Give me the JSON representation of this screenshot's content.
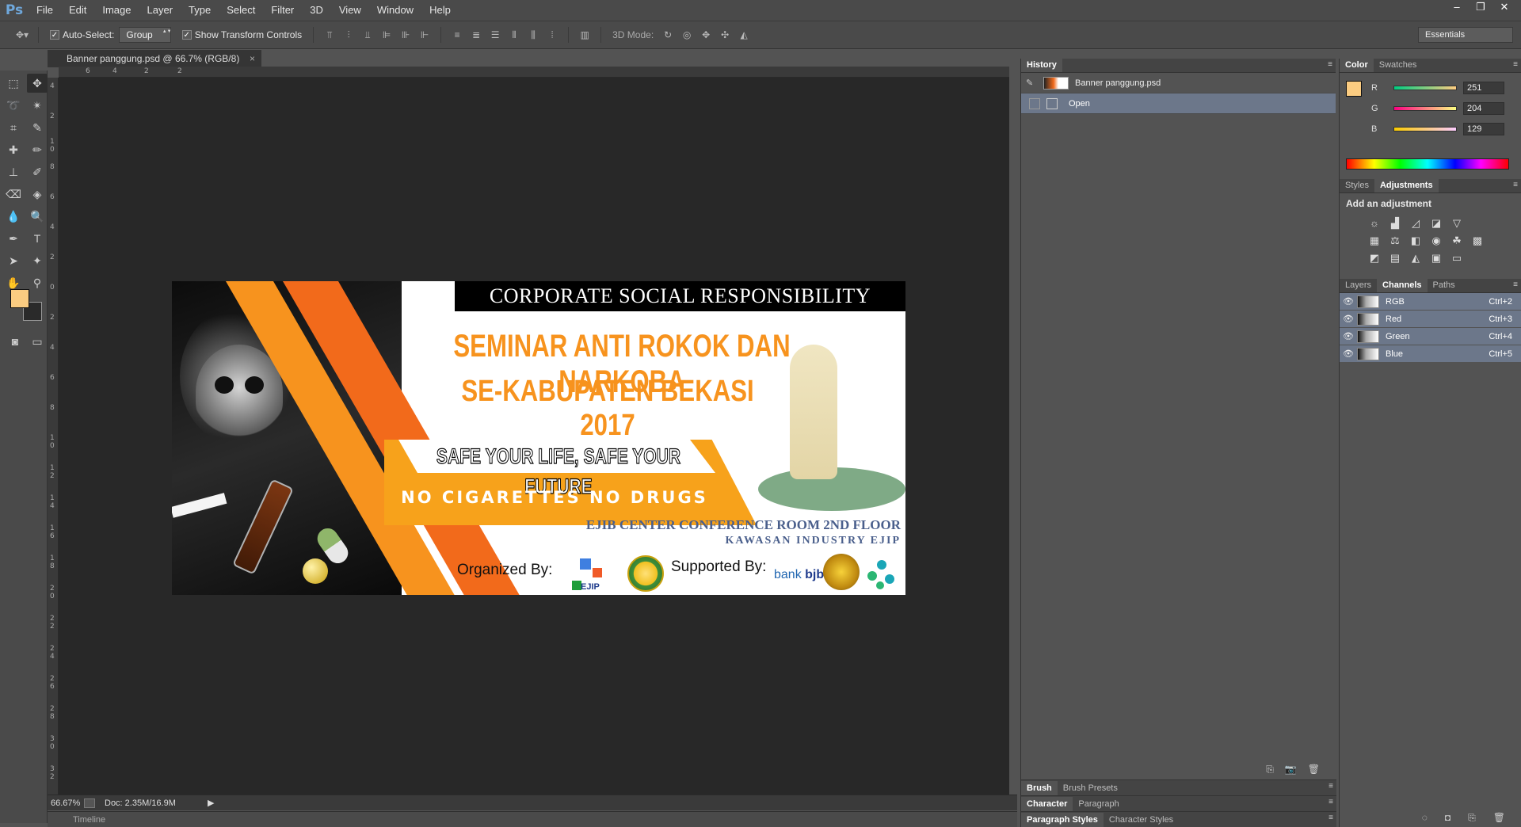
{
  "app": {
    "logo": "Ps",
    "menu": [
      "File",
      "Edit",
      "Image",
      "Layer",
      "Type",
      "Select",
      "Filter",
      "3D",
      "View",
      "Window",
      "Help"
    ],
    "window_controls": [
      "–",
      "❐",
      "✕"
    ]
  },
  "options": {
    "auto_select_label": "Auto-Select:",
    "auto_select_value": "Group",
    "show_transform_label": "Show Transform Controls",
    "mode_3d_label": "3D Mode:",
    "workspace": "Essentials"
  },
  "document": {
    "tab_title": "Banner panggung.psd @ 66.7% (RGB/8)",
    "tab_close": "×",
    "zoom": "66.67%",
    "doc_size": "Doc: 2.35M/16.9M",
    "ruler_top": [
      "6",
      "4",
      "2",
      "2"
    ],
    "ruler_left": [
      "4",
      "2",
      "1 0",
      "8",
      "6",
      "4",
      "2",
      "0",
      "2",
      "4",
      "6",
      "8",
      "1 0",
      "1 2",
      "1 4",
      "1 6",
      "1 8",
      "2 0",
      "2 2",
      "2 4",
      "2 6",
      "2 8",
      "3 0",
      "3 2"
    ]
  },
  "banner": {
    "csr": "CORPORATE SOCIAL RESPONSIBILITY",
    "title1": "SEMINAR ANTI ROKOK DAN NARKOBA",
    "title2": "SE-KABUPATEN BEKASI 2017",
    "slogan1": "SAFE YOUR LIFE, SAFE YOUR FUTURE",
    "slogan2": "NO CIGARETTES NO DRUGS",
    "venue1": "EJIB CENTER CONFERENCE ROOM 2ND FLOOR",
    "venue2": "KAWASAN INDUSTRY EJIP",
    "organized": "Organized By:",
    "supported": "Supported By:",
    "ejip_logo_text": "EJIP",
    "bjb_logo_text": "bank",
    "bjb_logo_bold": "bjb"
  },
  "statusbar": {
    "timeline": "Timeline"
  },
  "panels": {
    "history": {
      "tab": "History",
      "items": [
        {
          "label": "Banner panggung.psd",
          "selected": false
        },
        {
          "label": "Open",
          "selected": true
        }
      ]
    },
    "color": {
      "tabs": [
        "Color",
        "Swatches"
      ],
      "r": "251",
      "g": "204",
      "b": "129",
      "fg_hex": "#fbcc81",
      "r_label": "R",
      "g_label": "G",
      "b_label": "B"
    },
    "adjustments": {
      "tabs": [
        "Styles",
        "Adjustments"
      ],
      "title": "Add an adjustment"
    },
    "layers": {
      "tabs": [
        "Layers",
        "Channels",
        "Paths"
      ],
      "channels": [
        {
          "name": "RGB",
          "key": "Ctrl+2"
        },
        {
          "name": "Red",
          "key": "Ctrl+3"
        },
        {
          "name": "Green",
          "key": "Ctrl+4"
        },
        {
          "name": "Blue",
          "key": "Ctrl+5"
        }
      ]
    },
    "bottom": {
      "brush_tabs": [
        "Brush",
        "Brush Presets"
      ],
      "char_tabs": [
        "Character",
        "Paragraph"
      ],
      "style_tabs": [
        "Paragraph Styles",
        "Character Styles"
      ]
    }
  },
  "colors": {
    "accent_orange": "#f7931e",
    "accent_red_orange": "#f26a1b",
    "selection_blue": "#6c778a",
    "foreground": "#fbcc81"
  }
}
